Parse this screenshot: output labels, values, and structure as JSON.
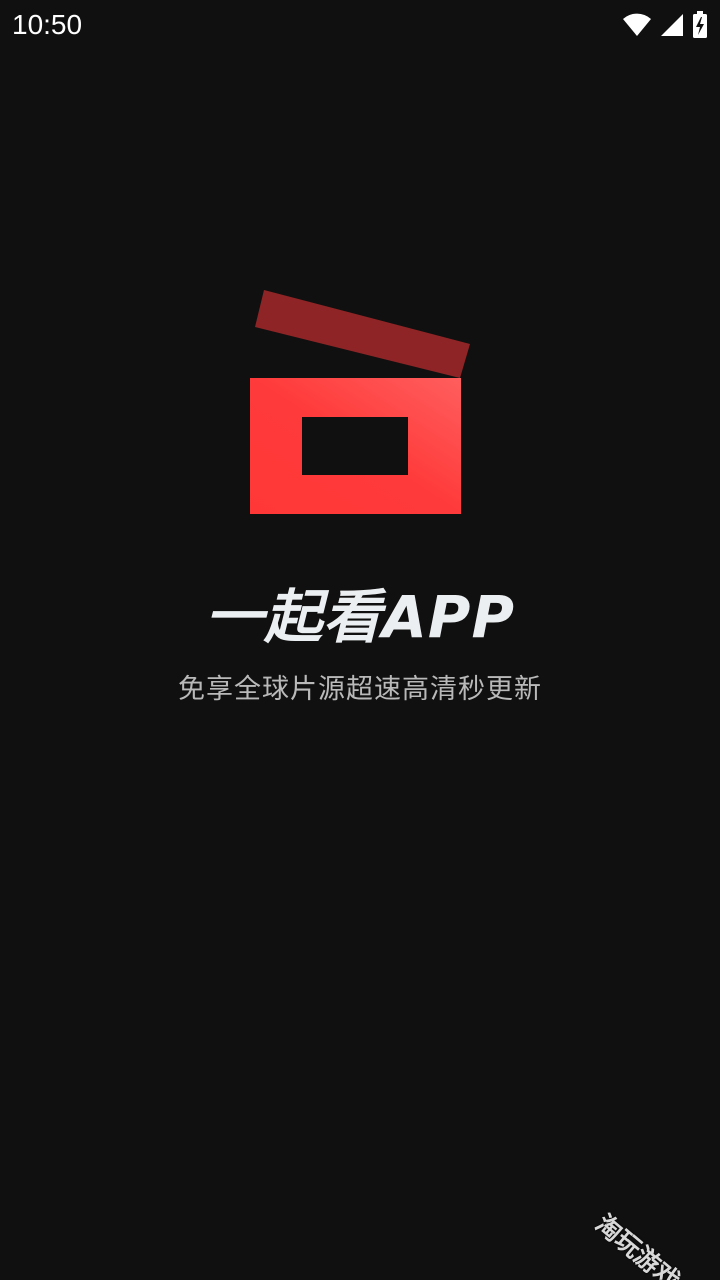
{
  "status_bar": {
    "time": "10:50",
    "icons": [
      "wifi-icon",
      "cell-signal-icon",
      "battery-charging-icon"
    ]
  },
  "splash": {
    "title": "一起看APP",
    "subtitle": "免享全球片源超速高清秒更新"
  },
  "watermark": {
    "text": "淘玩游戏"
  },
  "colors": {
    "background": "#101010",
    "logo_red": "#ff3b3b",
    "logo_red_light": "#ff5a5a",
    "logo_lid": "#8e2425",
    "title_text": "#eceff1",
    "subtitle_text": "#b9b9b9"
  }
}
